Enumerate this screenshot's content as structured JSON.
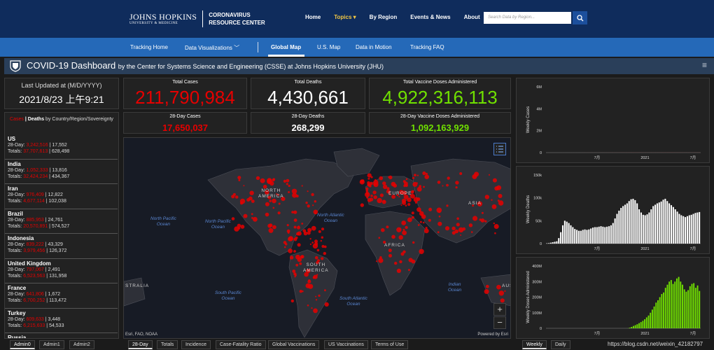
{
  "header": {
    "logo_line1": "JOHNS HOPKINS",
    "logo_line2": "UNIVERSITY & MEDICINE",
    "logo_title1": "CORONAVIRUS",
    "logo_title2": "RESOURCE CENTER",
    "nav": [
      "Home",
      "Topics ▾",
      "By Region",
      "Events & News",
      "About"
    ],
    "search_placeholder": "Search Data by Region...",
    "colors": {
      "bg": "#0f2c5c",
      "accent": "#f2c744"
    }
  },
  "subnav": {
    "items": [
      "Tracking Home",
      "Data Visualizations ﹀",
      "Global Map",
      "U.S. Map",
      "Data in Motion",
      "Tracking FAQ"
    ],
    "active": "Global Map"
  },
  "dashboard": {
    "title": "COVID-19 Dashboard",
    "subtitle": "by the Center for Systems Science and Engineering (CSSE) at Johns Hopkins University (JHU)"
  },
  "last_updated": {
    "label": "Last Updated at (M/D/YYYY)",
    "value": "2021/8/23 上午9:21"
  },
  "stats": {
    "total_cases": {
      "label": "Total Cases",
      "value": "211,790,984"
    },
    "total_deaths": {
      "label": "Total Deaths",
      "value": "4,430,661"
    },
    "total_vaccine": {
      "label": "Total Vaccine Doses Administered",
      "value": "4,922,316,113"
    },
    "cases_28": {
      "label": "28-Day Cases",
      "value": "17,650,037"
    },
    "deaths_28": {
      "label": "28-Day Deaths",
      "value": "268,299"
    },
    "vaccine_28": {
      "label": "28-Day Vaccine Doses Administered",
      "value": "1,092,163,929"
    }
  },
  "country_list": {
    "header_cases": "Cases",
    "header_sep": " | ",
    "header_deaths": "Deaths",
    "header_rest": "by Country/Region/Sovereignty",
    "rows": [
      {
        "name": "US",
        "d_cases": "3,242,516",
        "d_deaths": "17,552",
        "t_cases": "37,707,613",
        "t_deaths": "628,498"
      },
      {
        "name": "India",
        "d_cases": "1,052,333",
        "d_deaths": "13,816",
        "t_cases": "32,424,234",
        "t_deaths": "434,367"
      },
      {
        "name": "Iran",
        "d_cases": "976,409",
        "d_deaths": "12,822",
        "t_cases": "4,677,114",
        "t_deaths": "102,038"
      },
      {
        "name": "Brazil",
        "d_cases": "885,953",
        "d_deaths": "24,761",
        "t_cases": "20,570,891",
        "t_deaths": "574,527"
      },
      {
        "name": "Indonesia",
        "d_cases": "839,222",
        "d_deaths": "43,329",
        "t_cases": "3,979,456",
        "t_deaths": "126,372"
      },
      {
        "name": "United Kingdom",
        "d_cases": "797,067",
        "d_deaths": "2,491",
        "t_cases": "6,523,563",
        "t_deaths": "131,958"
      },
      {
        "name": "France",
        "d_cases": "641,806",
        "d_deaths": "1,672",
        "t_cases": "6,700,252",
        "t_deaths": "113,472"
      },
      {
        "name": "Turkey",
        "d_cases": "609,633",
        "d_deaths": "3,448",
        "t_cases": "6,215,633",
        "t_deaths": "54,533"
      },
      {
        "name": "Russia",
        "d_cases": "",
        "d_deaths": "",
        "t_cases": "",
        "t_deaths": ""
      }
    ],
    "label_28": "28-Day: ",
    "label_totals": "Totals: "
  },
  "map": {
    "labels": {
      "north_america": "NORTH\nAMERICA",
      "south_america": "SOUTH\nAMERICA",
      "europe": "EUROPE",
      "africa": "AFRICA",
      "asia": "ASIA",
      "north_pacific_1": "North Pacific\nOcean",
      "north_pacific_2": "North Pacific\nOcean",
      "north_atlantic": "North Atlantic\nOcean",
      "south_pacific": "South Pacific\nOcean",
      "south_atlantic": "South Atlantic\nOcean",
      "indian": "Indian\nOcean",
      "australia_left": "STRALIA",
      "australia_right": "AUS"
    },
    "attribution": "Esri, FAO, NOAA",
    "powered": "Powered by Esri",
    "zoom_in": "+",
    "zoom_out": "−"
  },
  "charts": {
    "cases": {
      "ylabel": "Weekly Cases",
      "yticks": [
        "0",
        "2M",
        "4M",
        "6M"
      ],
      "xticks": [
        "7月",
        "2021",
        "7月"
      ],
      "color": "#e60000"
    },
    "deaths": {
      "ylabel": "Weekly Deaths",
      "yticks": [
        "0",
        "50k",
        "100k",
        "150k"
      ],
      "xticks": [
        "7月",
        "2021",
        "7月"
      ],
      "color": "#ffffff"
    },
    "vaccine": {
      "ylabel": "Weekly Doses Administered",
      "yticks": [
        "0",
        "100M",
        "200M",
        "300M",
        "400M"
      ],
      "xticks": [
        "7月",
        "2021",
        "7月"
      ],
      "color": "#70e000"
    }
  },
  "chart_data": [
    {
      "type": "bar",
      "name": "Weekly Cases",
      "ylim": [
        0,
        6000000
      ],
      "values": [
        0,
        10,
        20,
        30,
        40,
        50,
        90,
        160,
        330,
        480,
        560,
        590,
        580,
        560,
        540,
        580,
        700,
        900,
        1200,
        1450,
        1600,
        1700,
        1800,
        1750,
        1700,
        1750,
        1850,
        1900,
        2000,
        2150,
        2300,
        2450,
        2700,
        2950,
        3150,
        3250,
        3450,
        3600,
        3750,
        3900,
        4050,
        4200,
        4400,
        4700,
        4950,
        5100,
        5000,
        4700,
        4200,
        3850,
        3500,
        3200,
        3050,
        2900,
        3050,
        3300,
        3550,
        3900,
        4250,
        4550,
        4900,
        5300,
        5600,
        5700,
        5550,
        5400,
        5100,
        4800,
        4400,
        3950,
        3650,
        3500,
        3600,
        3750,
        3950,
        4200,
        4450,
        4600,
        4700
      ]
    },
    {
      "type": "bar",
      "name": "Weekly Deaths",
      "ylim": [
        0,
        150000
      ],
      "values": [
        500,
        1000,
        2000,
        3000,
        4000,
        5000,
        12000,
        25000,
        40000,
        50000,
        48000,
        45000,
        40000,
        36000,
        32000,
        30000,
        28000,
        28000,
        30000,
        31000,
        30000,
        31000,
        33000,
        35000,
        36000,
        36000,
        37000,
        38000,
        37000,
        36000,
        37000,
        38000,
        40000,
        45000,
        55000,
        65000,
        72000,
        78000,
        82000,
        85000,
        88000,
        93000,
        97000,
        98000,
        95000,
        88000,
        75000,
        68000,
        63000,
        62000,
        64000,
        68000,
        75000,
        82000,
        85000,
        88000,
        90000,
        92000,
        96000,
        98000,
        93000,
        88000,
        84000,
        80000,
        75000,
        70000,
        65000,
        62000,
        60000,
        58000,
        60000,
        62000,
        63000,
        65000,
        67000,
        68000,
        69000
      ]
    },
    {
      "type": "bar",
      "name": "Weekly Doses Administered",
      "ylim": [
        0,
        400000000
      ],
      "values": [
        0,
        0,
        0,
        0,
        0,
        0,
        0,
        0,
        0,
        0,
        0,
        0,
        0,
        0,
        0,
        0,
        0,
        0,
        0,
        0,
        0,
        0,
        0,
        0,
        0,
        0,
        0,
        0,
        0,
        0,
        0,
        0,
        0,
        0,
        0,
        0,
        0,
        0,
        0,
        0,
        0,
        0,
        0,
        500000,
        4000000,
        9000000,
        15000000,
        20000000,
        26000000,
        33000000,
        40000000,
        48000000,
        58000000,
        70000000,
        82000000,
        100000000,
        120000000,
        140000000,
        165000000,
        180000000,
        200000000,
        220000000,
        230000000,
        260000000,
        280000000,
        300000000,
        310000000,
        285000000,
        300000000,
        320000000,
        330000000,
        300000000,
        280000000,
        250000000,
        235000000,
        245000000,
        270000000,
        285000000,
        290000000,
        260000000,
        275000000,
        240000000
      ]
    }
  ],
  "bottom": {
    "left_tabs": [
      "Admin0",
      "Admin1",
      "Admin2"
    ],
    "map_tabs": [
      "28-Day",
      "Totals",
      "Incidence",
      "Case-Fatality Ratio",
      "Global Vaccinations",
      "US Vaccinations",
      "Terms of Use"
    ],
    "chart_tabs": [
      "Weekly",
      "Daily"
    ],
    "watermark": "https://blog.csdn.net/weixin_42182797"
  }
}
